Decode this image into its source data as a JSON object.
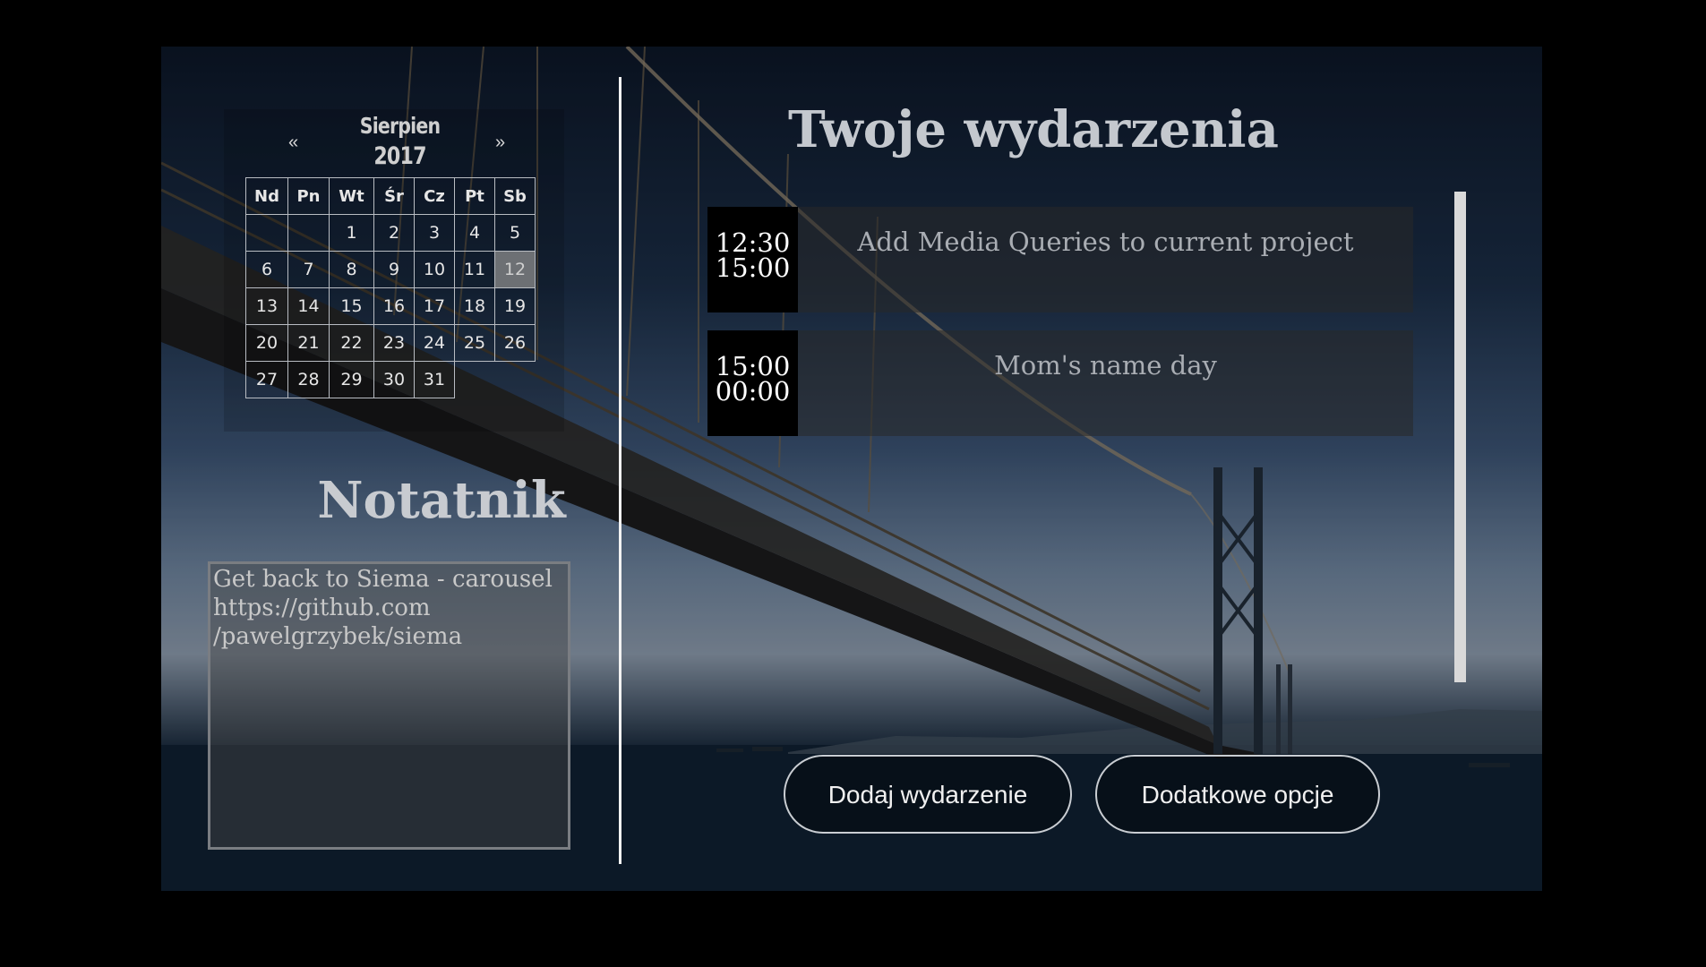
{
  "calendar": {
    "prev": "«",
    "next": "»",
    "month": "Sierpien",
    "year": "2017",
    "weekdays": [
      "Nd",
      "Pn",
      "Wt",
      "Śr",
      "Cz",
      "Pt",
      "Sb"
    ],
    "weeks": [
      [
        "",
        "",
        "1",
        "2",
        "3",
        "4",
        "5"
      ],
      [
        "6",
        "7",
        "8",
        "9",
        "10",
        "11",
        "12"
      ],
      [
        "13",
        "14",
        "15",
        "16",
        "17",
        "18",
        "19"
      ],
      [
        "20",
        "21",
        "22",
        "23",
        "24",
        "25",
        "26"
      ],
      [
        "27",
        "28",
        "29",
        "30",
        "31",
        "",
        ""
      ]
    ],
    "selected_day": "12"
  },
  "notes": {
    "title": "Notatnik",
    "content": "Get back to Siema - carousel https://github.com\n/pawelgrzybek/siema"
  },
  "events": {
    "title": "Twoje wydarzenia",
    "items": [
      {
        "start": "12:30",
        "end": "15:00",
        "title": "Add Media Queries to current project"
      },
      {
        "start": "15:00",
        "end": "00:00",
        "title": "Mom's name day"
      }
    ]
  },
  "buttons": {
    "add_event": "Dodaj wydarzenie",
    "more_options": "Dodatkowe opcje"
  },
  "colors": {
    "selected_day_bg": "#8c8c8c",
    "event_time_bg": "#000000",
    "divider": "#f2f2f2"
  }
}
